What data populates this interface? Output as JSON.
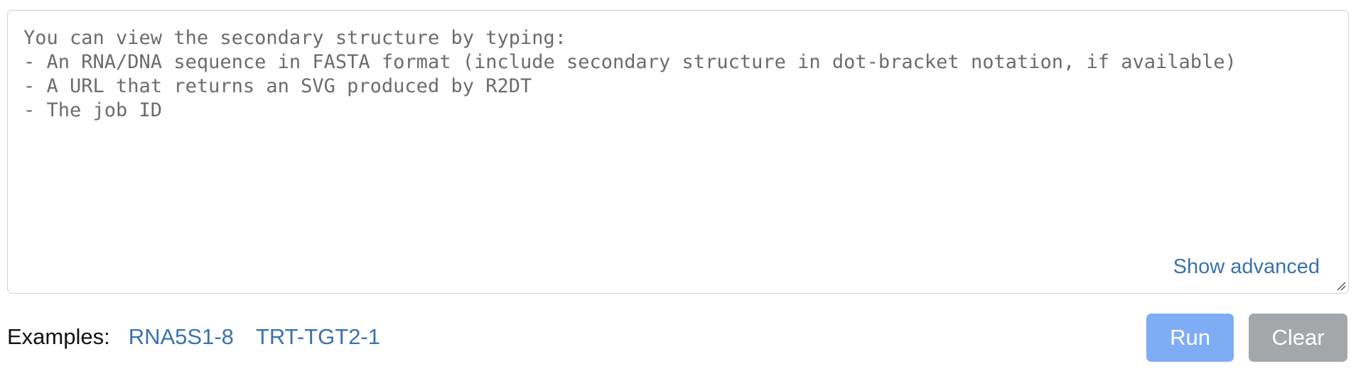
{
  "input": {
    "value": "",
    "placeholder": "You can view the secondary structure by typing:\n- An RNA/DNA sequence in FASTA format (include secondary structure in dot-bracket notation, if available)\n- A URL that returns an SVG produced by R2DT\n- The job ID",
    "show_advanced_label": "Show advanced"
  },
  "examples": {
    "label": "Examples:",
    "items": [
      {
        "label": "RNA5S1-8"
      },
      {
        "label": "TRT-TGT2-1"
      }
    ]
  },
  "actions": {
    "run_label": "Run",
    "clear_label": "Clear"
  },
  "colors": {
    "link": "#3a72ad",
    "run_button": "#7fadf5",
    "clear_button": "#a4a7aa",
    "border": "#cfd4d9",
    "placeholder_text": "#6c6c6c"
  }
}
